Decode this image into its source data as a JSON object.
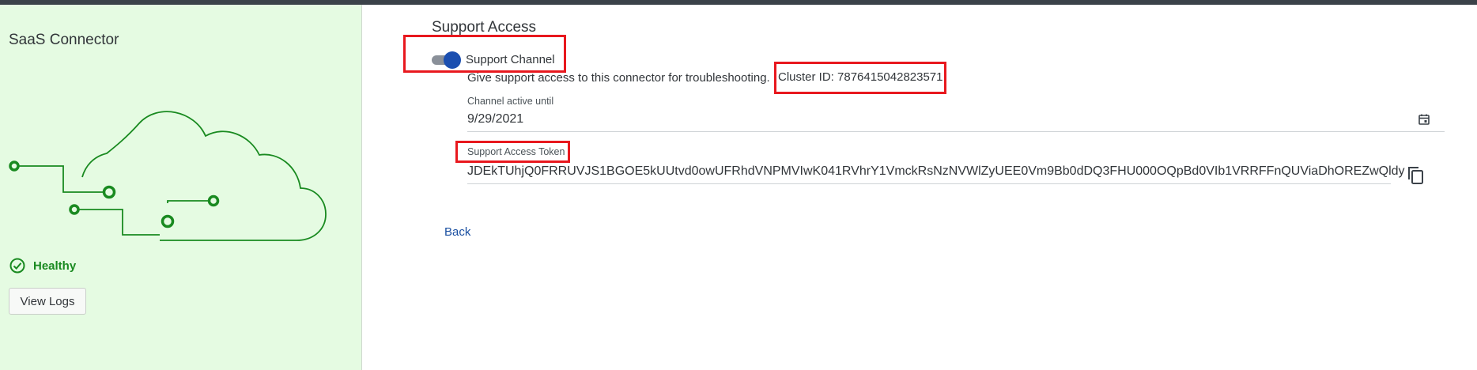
{
  "sidebar": {
    "title": "SaaS Connector",
    "status": "Healthy",
    "view_logs_label": "View Logs"
  },
  "main": {
    "section_title": "Support Access",
    "toggle": {
      "label": "Support Channel",
      "on": true
    },
    "description": "Give support access to this connector for troubleshooting.",
    "cluster_id": "Cluster ID: 7876415042823571",
    "channel_active": {
      "label": "Channel active until",
      "value": "9/29/2021",
      "icon": "calendar-icon"
    },
    "token": {
      "label": "Support Access Token",
      "value": "JDEkTUhjQ0FRRUVJS1BGOE5kUUtvd0owUFRhdVNPMVIwK041RVhrY1VmckRsNzNVWlZyUEE0Vm9Bb0dDQ3FHU000OQpBd0VIb1VRRFFnQUViaDhOREZwQldy",
      "icon": "copy-icon"
    },
    "back_label": "Back"
  },
  "colors": {
    "sidebar_bg": "#e5fbe2",
    "accent_green": "#198a20",
    "toggle_blue": "#1b4fb0",
    "link_blue": "#1a4fa1",
    "highlight_red": "#e8181e"
  }
}
